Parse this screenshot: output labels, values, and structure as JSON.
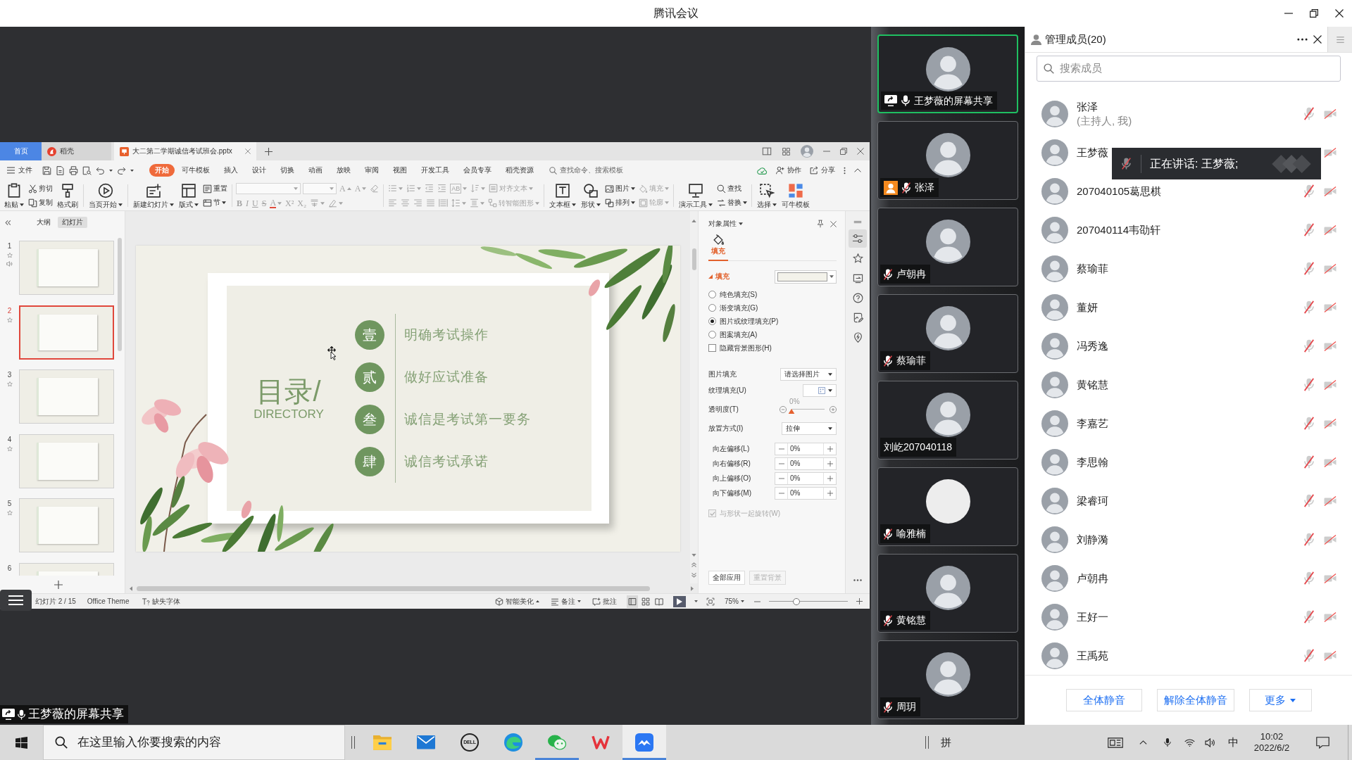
{
  "window": {
    "title": "腾讯会议"
  },
  "shared_screen": {
    "label": "王梦薇的屏幕共享",
    "muted": false,
    "presentation": {
      "tabs": [
        {
          "label": "首页",
          "kind": "home",
          "selected": false
        },
        {
          "label": "稻壳",
          "kind": "docer",
          "selected": false
        },
        {
          "label": "大二第二学期诚信考试班会.pptx",
          "kind": "document",
          "selected": true
        }
      ],
      "file_menu": "文件",
      "menu_tabs": [
        {
          "label": "开始",
          "selected": true
        },
        {
          "label": "可牛模板",
          "selected": false
        },
        {
          "label": "插入",
          "selected": false
        },
        {
          "label": "设计",
          "selected": false
        },
        {
          "label": "切换",
          "selected": false
        },
        {
          "label": "动画",
          "selected": false
        },
        {
          "label": "放映",
          "selected": false
        },
        {
          "label": "审阅",
          "selected": false
        },
        {
          "label": "视图",
          "selected": false
        },
        {
          "label": "开发工具",
          "selected": false
        },
        {
          "label": "会员专享",
          "selected": false
        },
        {
          "label": "稻壳资源",
          "selected": false
        }
      ],
      "command_search": {
        "placeholder": "查找命令、搜索模板"
      },
      "menu_actions": [
        {
          "label": "协作",
          "kind": "collaborate"
        },
        {
          "label": "分享",
          "kind": "share"
        }
      ],
      "ribbon": [
        {
          "kind": "columns",
          "columns": [
            [
              {
                "label": "粘贴",
                "kind": "paste",
                "caret": true
              }
            ],
            [
              {
                "label": "剪切",
                "kind": "cut"
              },
              {
                "label": "复制",
                "kind": "copy"
              }
            ],
            [
              {
                "label": "格式刷",
                "kind": "format-painter"
              }
            ]
          ]
        },
        {
          "kind": "columns",
          "columns": [
            [
              {
                "label": "当页开始",
                "kind": "play-from-current",
                "caret": true
              }
            ]
          ]
        },
        {
          "kind": "columns",
          "columns": [
            [
              {
                "label": "新建幻灯片",
                "kind": "new-slide",
                "caret": true
              }
            ],
            [
              {
                "label": "版式",
                "kind": "layout",
                "caret": true
              }
            ],
            [
              {
                "label": "重置",
                "kind": "reset"
              },
              {
                "label": "节",
                "kind": "section",
                "caret": true
              }
            ]
          ]
        },
        {
          "kind": "rows",
          "disabled": true,
          "rows": [
            [
              {
                "kind": "font-box"
              },
              {
                "kind": "size-box"
              },
              {
                "kind": "grow",
                "text": "A"
              },
              {
                "kind": "shrink",
                "text": "A"
              },
              {
                "kind": "clear"
              }
            ],
            [
              {
                "kind": "bold",
                "text": "B"
              },
              {
                "kind": "italic",
                "text": "I"
              },
              {
                "kind": "underline",
                "text": "U"
              },
              {
                "kind": "strike",
                "text": "S"
              },
              {
                "kind": "color",
                "text": "A",
                "caret": true
              },
              {
                "kind": "superscript",
                "text": "X²"
              },
              {
                "kind": "subscript",
                "text": "X₂"
              },
              {
                "kind": "phonetic",
                "caret": true
              },
              {
                "kind": "highlight",
                "caret": true
              }
            ]
          ]
        },
        {
          "kind": "rows",
          "disabled": true,
          "rows": [
            [
              {
                "kind": "bullets",
                "caret": true
              },
              {
                "kind": "numbering",
                "caret": true
              },
              {
                "kind": "outdent"
              },
              {
                "kind": "indent"
              },
              {
                "kind": "direction",
                "text": "AB",
                "caret": true
              },
              {
                "kind": "sort",
                "caret": true
              },
              {
                "kind": "align-text",
                "label": "对齐文本",
                "caret": true
              }
            ],
            [
              {
                "kind": "align-left"
              },
              {
                "kind": "align-center"
              },
              {
                "kind": "align-right"
              },
              {
                "kind": "justify"
              },
              {
                "kind": "distribute"
              },
              {
                "kind": "line-spacing",
                "caret": true
              },
              {
                "kind": "para-spacing",
                "caret": true
              },
              {
                "kind": "smart-art",
                "label": "转智能图形",
                "caret": true
              }
            ]
          ]
        },
        {
          "kind": "columns",
          "columns": [
            [
              {
                "label": "文本框",
                "kind": "textbox",
                "caret": true
              }
            ],
            [
              {
                "label": "形状",
                "kind": "shape",
                "caret": true
              }
            ],
            [
              {
                "label": "图片",
                "kind": "picture",
                "caret": true
              },
              {
                "label": "排列",
                "kind": "arrange",
                "caret": true
              }
            ],
            [
              {
                "label": "填充",
                "kind": "fill",
                "caret": true,
                "disabled": true
              },
              {
                "label": "轮廓",
                "kind": "outline",
                "caret": true,
                "disabled": true
              }
            ]
          ]
        },
        {
          "kind": "columns",
          "columns": [
            [
              {
                "label": "演示工具",
                "kind": "presentation-tools",
                "caret": true
              }
            ],
            [
              {
                "label": "查找",
                "kind": "find"
              },
              {
                "label": "替换",
                "kind": "replace",
                "caret": true
              }
            ]
          ]
        },
        {
          "kind": "columns",
          "columns": [
            [
              {
                "label": "选择",
                "kind": "select",
                "caret": true
              }
            ],
            [
              {
                "label": "可牛模板",
                "kind": "template"
              }
            ]
          ]
        }
      ],
      "panel_tabs": [
        {
          "label": "大纲",
          "selected": false
        },
        {
          "label": "幻灯片",
          "selected": true
        }
      ],
      "slides": [
        {
          "number": "1",
          "selected": false,
          "animated": true,
          "audio": true
        },
        {
          "number": "2",
          "selected": true,
          "animated": true,
          "audio": false
        },
        {
          "number": "3",
          "selected": false,
          "animated": true,
          "audio": false
        },
        {
          "number": "4",
          "selected": false,
          "animated": true,
          "audio": false
        },
        {
          "number": "5",
          "selected": false,
          "animated": true,
          "audio": false
        },
        {
          "number": "6",
          "selected": false,
          "animated": false,
          "audio": false
        }
      ],
      "slide": {
        "title": "目录/",
        "subtitle": "DIRECTORY",
        "items": [
          {
            "numeral": "壹",
            "text": "明确考试操作"
          },
          {
            "numeral": "贰",
            "text": "做好应试准备"
          },
          {
            "numeral": "叁",
            "text": "诚信是考试第一要务"
          },
          {
            "numeral": "肆",
            "text": "诚信考试承诺"
          }
        ]
      },
      "properties": {
        "title": "对象属性",
        "tabs": [
          {
            "label": "填充",
            "selected": true
          }
        ],
        "section": {
          "label": "填充",
          "expanded": true
        },
        "fill_options": [
          {
            "label": "纯色填充(S)",
            "kind": "radio",
            "checked": false
          },
          {
            "label": "渐变填充(G)",
            "kind": "radio",
            "checked": false
          },
          {
            "label": "图片或纹理填充(P)",
            "kind": "radio",
            "checked": true
          },
          {
            "label": "图案填充(A)",
            "kind": "radio",
            "checked": false
          },
          {
            "label": "隐藏背景图形(H)",
            "kind": "checkbox",
            "checked": false
          }
        ],
        "picture_fill": {
          "label": "图片填充",
          "value": "请选择图片"
        },
        "texture_fill": {
          "label": "纹理填充(U)"
        },
        "transparency": {
          "label": "透明度(T)",
          "reading": "0%",
          "level": 0
        },
        "placement": {
          "label": "放置方式(I)",
          "value": "拉伸"
        },
        "offsets": [
          {
            "label": "向左偏移(L)",
            "value": "0%"
          },
          {
            "label": "向右偏移(R)",
            "value": "0%"
          },
          {
            "label": "向上偏移(O)",
            "value": "0%"
          },
          {
            "label": "向下偏移(M)",
            "value": "0%"
          }
        ],
        "rotate_with_shape": {
          "label": "与形状一起旋转(W)",
          "checked": true,
          "disabled": true
        },
        "buttons": [
          {
            "label": "全部应用",
            "disabled": false
          },
          {
            "label": "重置背景",
            "disabled": true
          }
        ]
      },
      "status_bar": {
        "slide_count": "幻灯片 2 / 15",
        "theme": "Office Theme",
        "missing_fonts": "缺失字体",
        "beautify": "智能美化",
        "notes": "备注",
        "comments": "批注",
        "views": [
          {
            "kind": "normal",
            "selected": true
          },
          {
            "kind": "sorter",
            "selected": false
          },
          {
            "kind": "reading",
            "selected": false
          }
        ],
        "zoom": "75%",
        "zoom_slider": {
          "level": 0.35
        }
      }
    }
  },
  "videos": [
    {
      "name": "王梦薇的屏幕共享",
      "speaking": true,
      "sharing": true,
      "host": false,
      "muted": false,
      "photo": true
    },
    {
      "name": "张泽",
      "speaking": false,
      "sharing": false,
      "host": true,
      "muted": true,
      "photo": true
    },
    {
      "name": "卢朝冉",
      "speaking": false,
      "sharing": false,
      "host": false,
      "muted": true,
      "photo": true
    },
    {
      "name": "蔡瑜菲",
      "speaking": false,
      "sharing": false,
      "host": false,
      "muted": true,
      "photo": true
    },
    {
      "name": "刘屹207040118",
      "speaking": false,
      "sharing": false,
      "host": false,
      "photo": true
    },
    {
      "name": "喻雅楠",
      "speaking": false,
      "sharing": false,
      "host": false,
      "muted": true,
      "photo": false
    },
    {
      "name": "黄铭慧",
      "speaking": false,
      "sharing": false,
      "host": false,
      "muted": true,
      "photo": true
    },
    {
      "name": "周玥",
      "speaking": false,
      "sharing": false,
      "host": false,
      "muted": true,
      "photo": true
    }
  ],
  "members": {
    "title": "管理成员(20)",
    "search": {
      "placeholder": "搜索成员"
    },
    "list": [
      {
        "name": "张泽",
        "note": "(主持人, 我)",
        "muted": true,
        "camera_on": false
      },
      {
        "name": "王梦薇",
        "tooltip": "正在讲话: 王梦薇;",
        "camera_on": false
      },
      {
        "name": "207040105葛思棋",
        "muted": true,
        "camera_on": false
      },
      {
        "name": "207040114韦劭轩",
        "muted": true,
        "camera_on": false
      },
      {
        "name": "蔡瑜菲",
        "muted": true,
        "camera_on": false
      },
      {
        "name": "董妍",
        "muted": true,
        "camera_on": false
      },
      {
        "name": "冯秀逸",
        "muted": true,
        "camera_on": false
      },
      {
        "name": "黄铭慧",
        "muted": true,
        "camera_on": false
      },
      {
        "name": "李嘉艺",
        "muted": true,
        "camera_on": false
      },
      {
        "name": "李思翰",
        "muted": true,
        "camera_on": false
      },
      {
        "name": "梁睿珂",
        "muted": true,
        "camera_on": false
      },
      {
        "name": "刘静漪",
        "muted": true,
        "camera_on": false
      },
      {
        "name": "卢朝冉",
        "muted": true,
        "camera_on": false
      },
      {
        "name": "王好一",
        "muted": true,
        "camera_on": false
      },
      {
        "name": "王禹苑",
        "muted": true,
        "camera_on": false
      }
    ],
    "buttons": [
      {
        "label": "全体静音"
      },
      {
        "label": "解除全体静音"
      },
      {
        "label": "更多",
        "caret": true
      }
    ]
  },
  "taskbar": {
    "search": {
      "placeholder": "在这里输入你要搜索的内容"
    },
    "apps": [
      {
        "kind": "explorer",
        "running": false,
        "active": false
      },
      {
        "kind": "mail",
        "running": false,
        "active": false
      },
      {
        "kind": "dell",
        "label": "DELL",
        "running": false,
        "active": false
      },
      {
        "kind": "edge",
        "running": false,
        "active": false
      },
      {
        "kind": "wechat",
        "running": true,
        "active": false
      },
      {
        "kind": "wps",
        "running": false,
        "active": false
      },
      {
        "kind": "meeting",
        "running": true,
        "active": true
      }
    ],
    "ime": "拼",
    "language": "中",
    "time": "10:02",
    "date": "2022/6/2"
  }
}
